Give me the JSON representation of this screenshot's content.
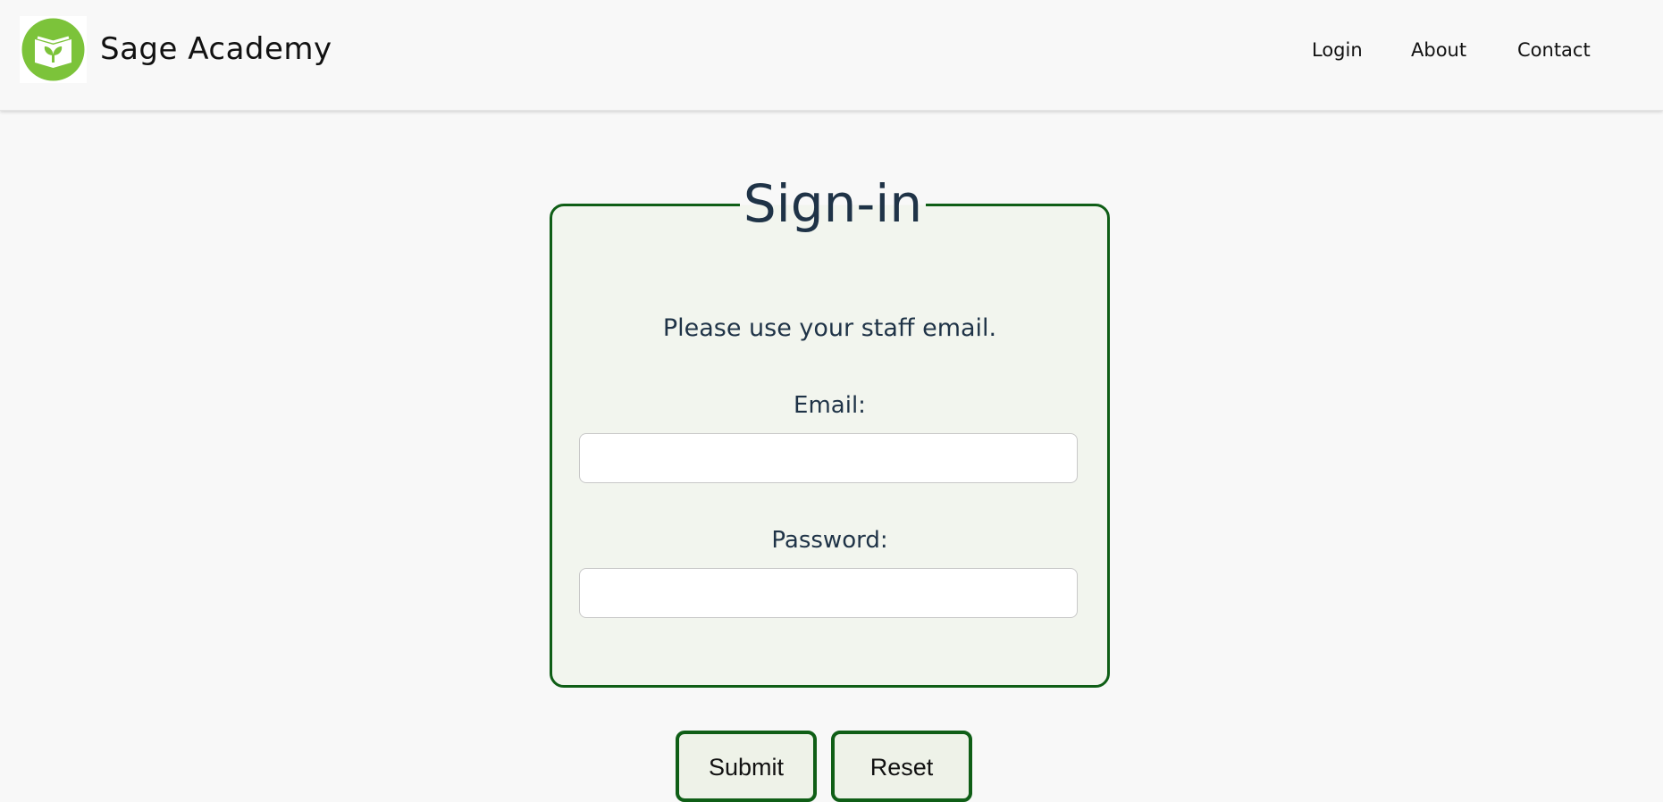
{
  "header": {
    "brand": "Sage Academy",
    "logo_icon": "book-sprout-icon",
    "nav": {
      "login": "Login",
      "about": "About",
      "contact": "Contact"
    }
  },
  "signin": {
    "title": "Sign-in",
    "hint": "Please use your staff email.",
    "email_label": "Email:",
    "email_value": "",
    "password_label": "Password:",
    "password_value": ""
  },
  "actions": {
    "submit_label": "Submit",
    "reset_label": "Reset"
  },
  "colors": {
    "accent_green": "#0f5e16",
    "logo_green": "#7cc33a",
    "text_navy": "#1f3347",
    "card_bg": "#f2f5ee"
  }
}
